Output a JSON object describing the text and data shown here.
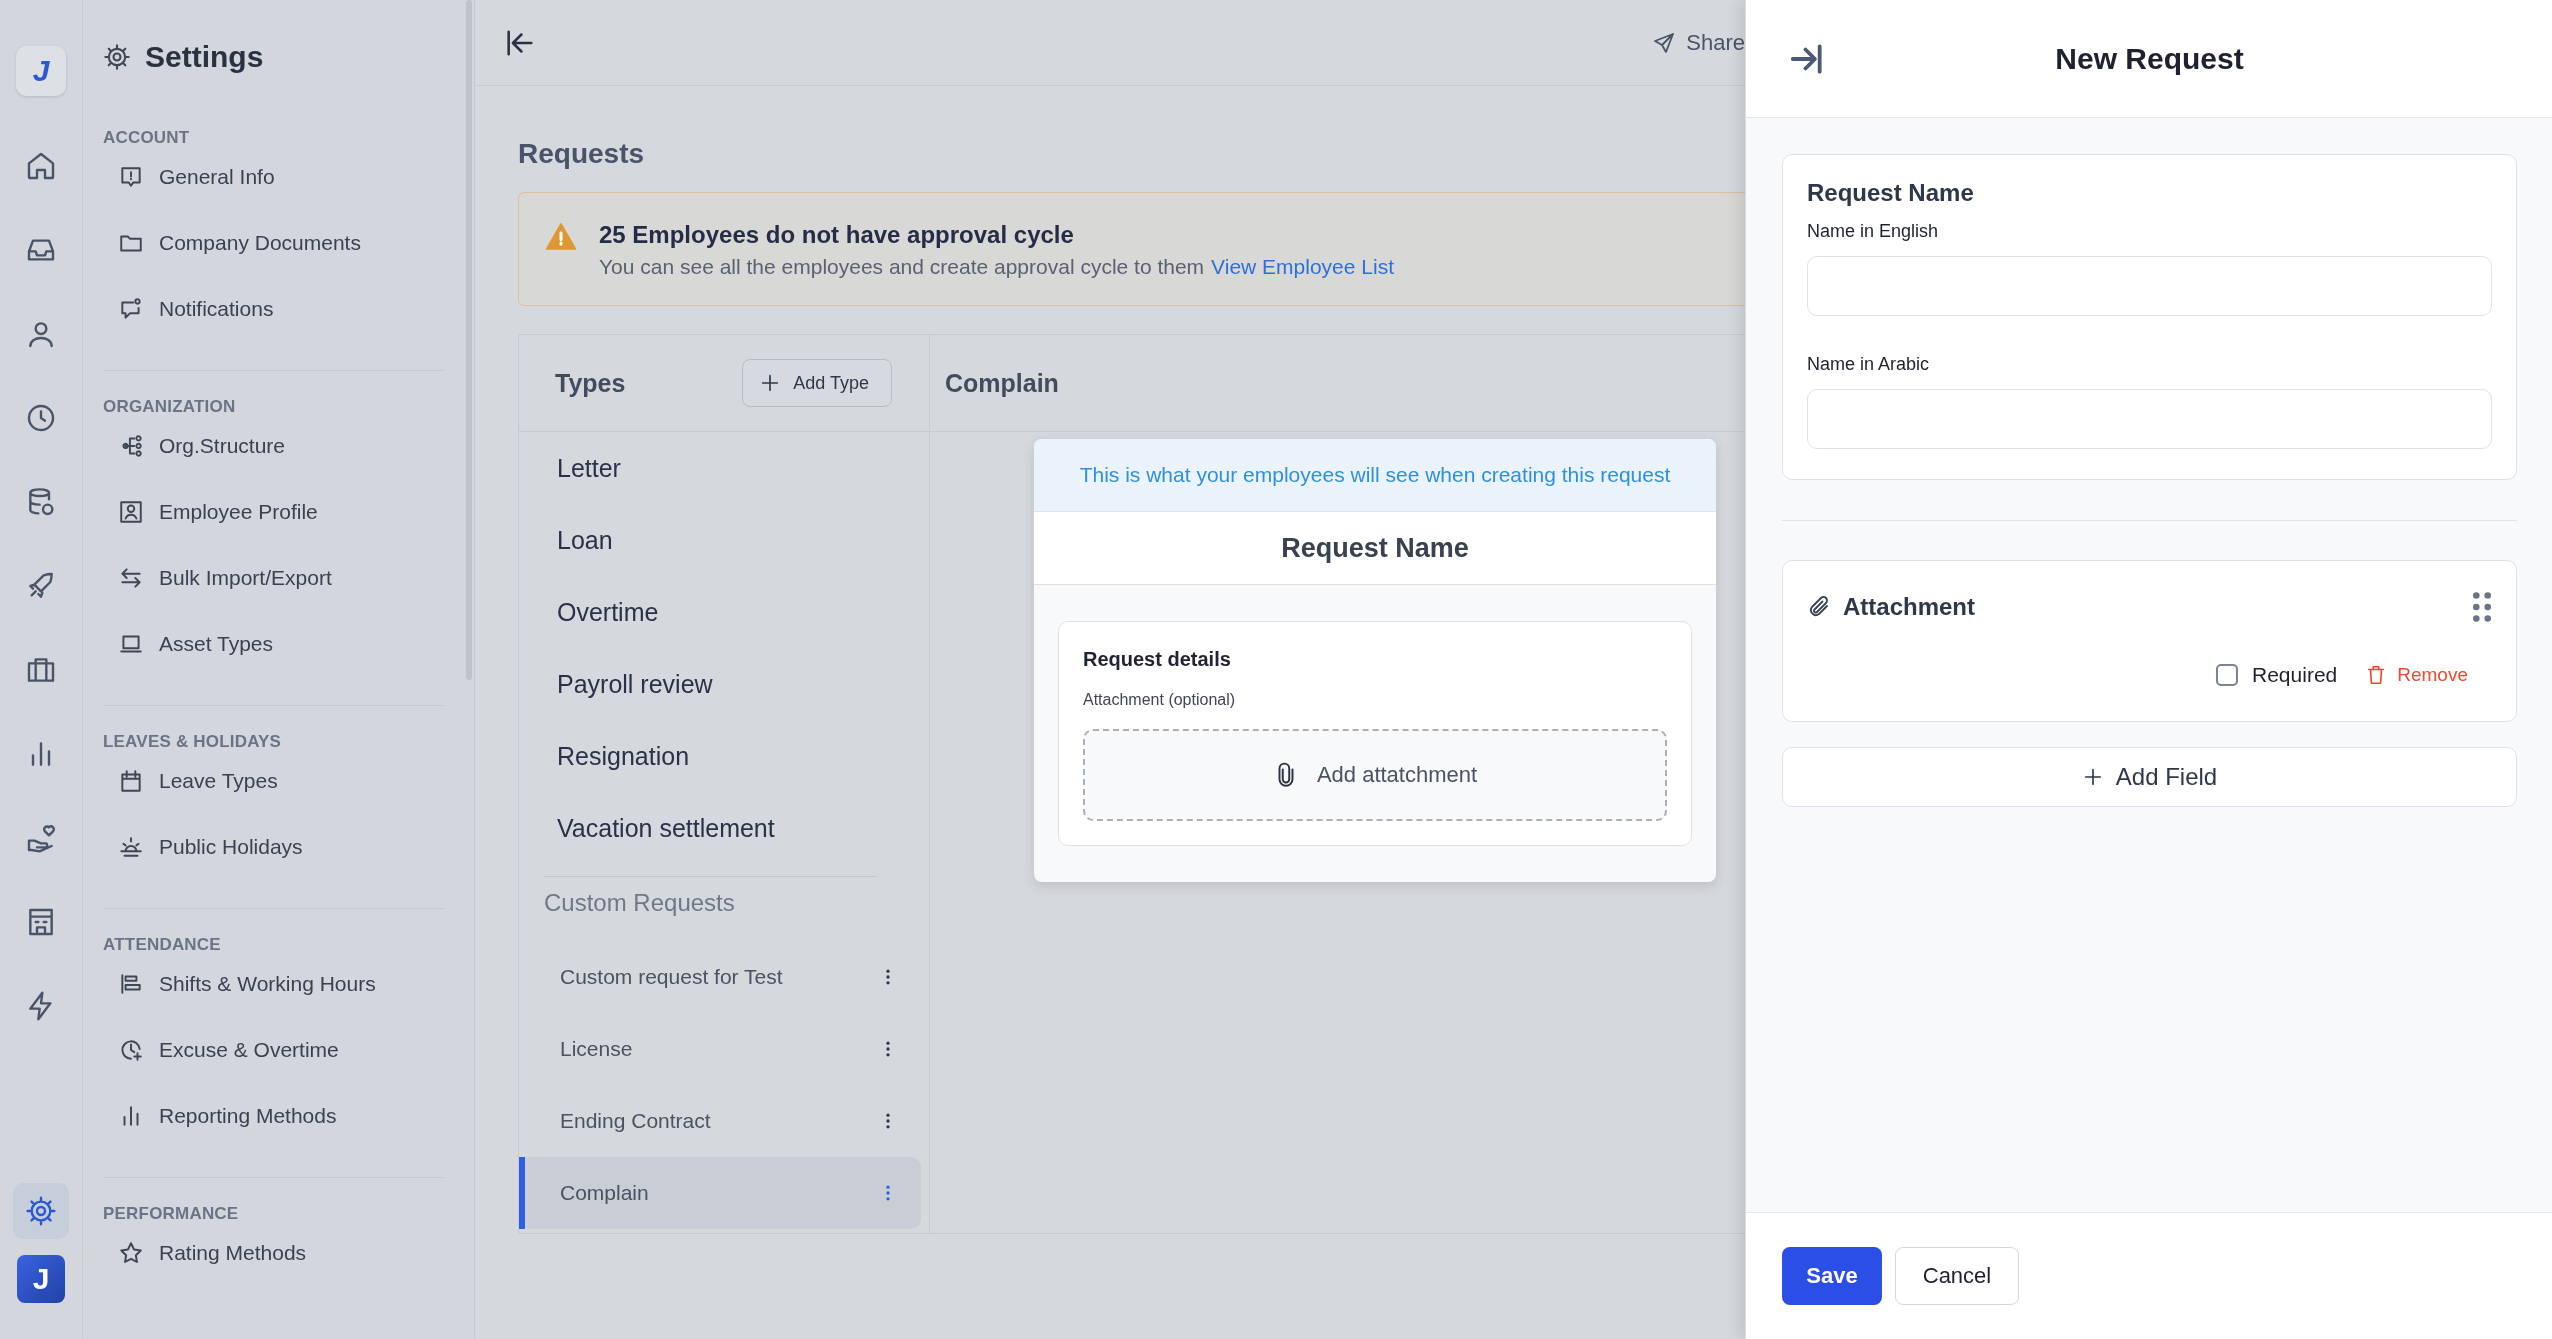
{
  "rail": {
    "logo": "J",
    "items": [
      {
        "kind": "home",
        "selected": false
      },
      {
        "kind": "inbox",
        "selected": false
      },
      {
        "kind": "user",
        "selected": false
      },
      {
        "kind": "clock",
        "selected": false
      },
      {
        "kind": "database",
        "selected": false
      },
      {
        "kind": "rocket",
        "selected": false
      },
      {
        "kind": "briefcase",
        "selected": false
      },
      {
        "kind": "chart",
        "selected": false
      },
      {
        "kind": "hand-heart",
        "selected": false
      },
      {
        "kind": "building",
        "selected": false
      },
      {
        "kind": "bolt",
        "selected": false
      }
    ],
    "bottom_items": [
      {
        "kind": "gear",
        "selected": true
      }
    ],
    "avatar": "J"
  },
  "sidebar": {
    "title": "Settings",
    "sections": [
      {
        "heading": "ACCOUNT",
        "items": [
          {
            "label": "General Info",
            "kind": "info"
          },
          {
            "label": "Company Documents",
            "kind": "folder"
          },
          {
            "label": "Notifications",
            "kind": "bell-chat"
          }
        ]
      },
      {
        "heading": "ORGANIZATION",
        "items": [
          {
            "label": "Org.Structure",
            "kind": "tree"
          },
          {
            "label": "Employee Profile",
            "kind": "id-card"
          },
          {
            "label": "Bulk Import/Export",
            "kind": "arrows"
          },
          {
            "label": "Asset Types",
            "kind": "laptop"
          }
        ]
      },
      {
        "heading": "LEAVES & HOLIDAYS",
        "items": [
          {
            "label": "Leave Types",
            "kind": "calendar"
          },
          {
            "label": "Public Holidays",
            "kind": "sunrise"
          }
        ]
      },
      {
        "heading": "ATTENDANCE",
        "items": [
          {
            "label": "Shifts & Working Hours",
            "kind": "bars"
          },
          {
            "label": "Excuse & Overtime",
            "kind": "clock-plus"
          },
          {
            "label": "Reporting Methods",
            "kind": "chart"
          }
        ]
      },
      {
        "heading": "PERFORMANCE",
        "items": [
          {
            "label": "Rating Methods",
            "kind": "star"
          }
        ]
      }
    ]
  },
  "header": {
    "share": "Share"
  },
  "page": {
    "title": "Requests",
    "banner": {
      "title": "25 Employees do not have approval cycle",
      "text": "You can see all the employees and create approval cycle to them",
      "link": "View Employee List"
    },
    "types": {
      "title": "Types",
      "add_button": "Add Type",
      "items": [
        "Letter",
        "Loan",
        "Overtime",
        "Payroll review",
        "Resignation",
        "Vacation settlement"
      ],
      "custom_heading": "Custom Requests",
      "custom_items": [
        {
          "label": "Custom request for Test",
          "selected": false
        },
        {
          "label": "License",
          "selected": false
        },
        {
          "label": "Ending Contract",
          "selected": false
        },
        {
          "label": "Complain",
          "selected": true
        }
      ]
    },
    "detail": {
      "title": "Complain",
      "preview": {
        "note": "This is what your employees will see when creating this request",
        "title": "Request Name",
        "section": "Request details",
        "field_label": "Attachment (optional)",
        "upload": "Add attatchment"
      }
    }
  },
  "panel": {
    "title": "New Request",
    "name_card": {
      "title": "Request Name",
      "fields": [
        {
          "label": "Name in English"
        },
        {
          "label": "Name in Arabic"
        }
      ]
    },
    "attachment": {
      "title": "Attachment",
      "required": {
        "label": "Required",
        "checked": false
      },
      "remove": "Remove"
    },
    "add_field": "Add Field",
    "buttons": {
      "save": "Save",
      "cancel": "Cancel"
    }
  }
}
